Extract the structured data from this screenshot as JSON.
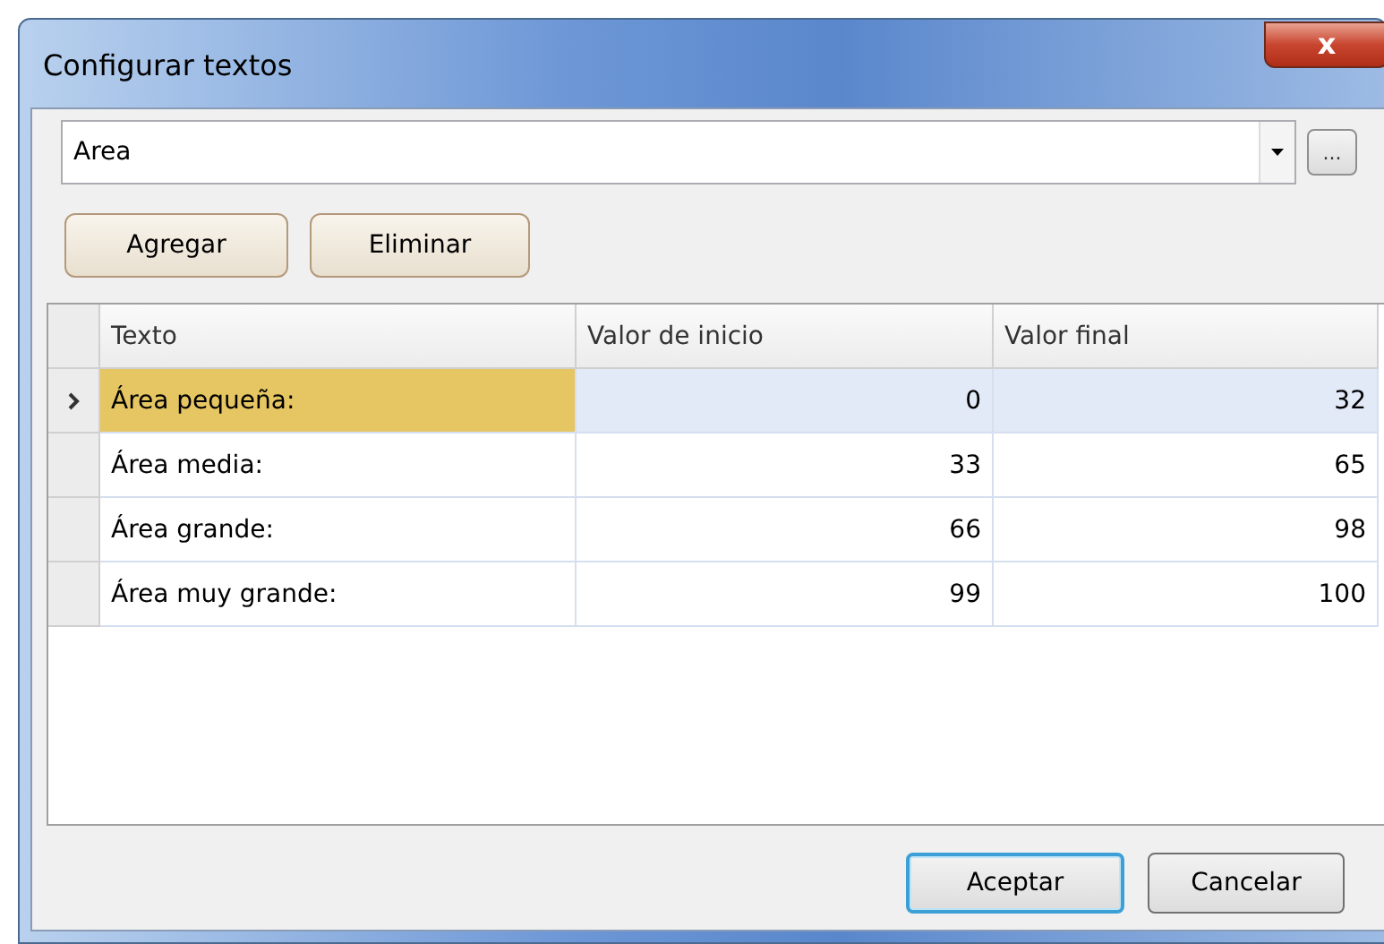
{
  "window": {
    "title": "Configurar textos",
    "close_icon": "x"
  },
  "selector": {
    "value": "Area",
    "browse_label": "..."
  },
  "actions": [
    "Agregar",
    "Eliminar"
  ],
  "table": {
    "columns": [
      "Texto",
      "Valor de inicio",
      "Valor final"
    ],
    "rows": [
      {
        "texto": "Área pequeña:",
        "inicio": "0",
        "final": "32",
        "selected": true
      },
      {
        "texto": "Área media:",
        "inicio": "33",
        "final": "65",
        "selected": false
      },
      {
        "texto": "Área grande:",
        "inicio": "66",
        "final": "98",
        "selected": false
      },
      {
        "texto": "Área muy grande:",
        "inicio": "99",
        "final": "100",
        "selected": false
      }
    ]
  },
  "buttons": [
    {
      "label": "Aceptar",
      "default": true
    },
    {
      "label": "Cancelar",
      "default": false
    }
  ]
}
